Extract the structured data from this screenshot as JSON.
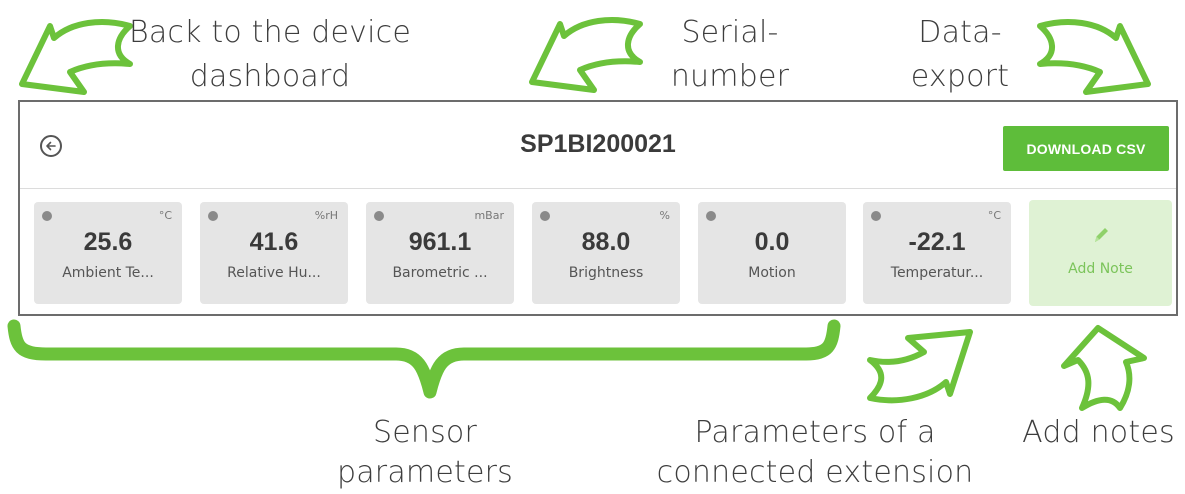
{
  "annotations": {
    "back": "Back to the device dashboard",
    "back_line1": "Back to the device",
    "back_line2": "dashboard",
    "serial_line1": "Serial-",
    "serial_line2": "number",
    "export_line1": "Data-",
    "export_line2": "export",
    "sensor_line1": "Sensor",
    "sensor_line2": "parameters",
    "extension_line1": "Parameters of a",
    "extension_line2": "connected extension",
    "notes": "Add notes"
  },
  "header": {
    "serial_number": "SP1BI200021",
    "download_label": "DOWNLOAD CSV",
    "back_icon": "arrow-left-circle-icon"
  },
  "sensors": [
    {
      "unit": "°C",
      "value": "25.6",
      "label": "Ambient Te..."
    },
    {
      "unit": "%rH",
      "value": "41.6",
      "label": "Relative Hu..."
    },
    {
      "unit": "mBar",
      "value": "961.1",
      "label": "Barometric ..."
    },
    {
      "unit": "%",
      "value": "88.0",
      "label": "Brightness"
    },
    {
      "unit": "",
      "value": "0.0",
      "label": "Motion"
    },
    {
      "unit": "°C",
      "value": "-22.1",
      "label": "Temperatur..."
    }
  ],
  "note_card": {
    "label": "Add Note",
    "icon": "pencil-icon"
  },
  "colors": {
    "accent_green": "#5ebd3a",
    "arrow_green": "#6cc23b",
    "card_bg": "#e5e5e5",
    "note_bg": "#dff2d4"
  }
}
